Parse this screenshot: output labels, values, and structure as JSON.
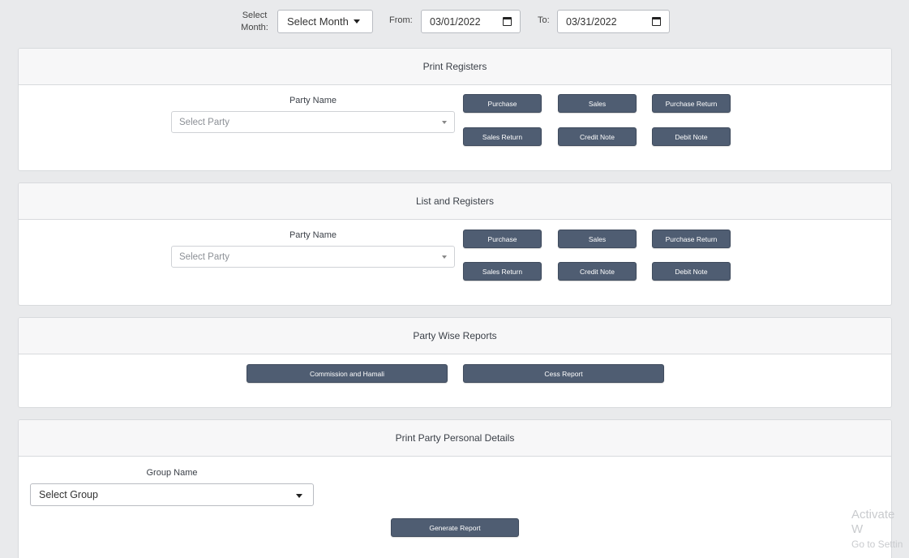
{
  "filters": {
    "month_label": "Select Month:",
    "month_value": "Select Month",
    "from_label": "From:",
    "from_value": "03/01/2022",
    "to_label": "To:",
    "to_value": "03/31/2022"
  },
  "print_registers": {
    "title": "Print Registers",
    "party_label": "Party Name",
    "party_placeholder": "Select Party",
    "buttons": [
      "Purchase",
      "Sales",
      "Purchase Return",
      "Sales Return",
      "Credit Note",
      "Debit Note"
    ]
  },
  "list_registers": {
    "title": "List and Registers",
    "party_label": "Party Name",
    "party_placeholder": "Select Party",
    "buttons": [
      "Purchase",
      "Sales",
      "Purchase Return",
      "Sales Return",
      "Credit Note",
      "Debit Note"
    ]
  },
  "party_wise": {
    "title": "Party Wise Reports",
    "buttons": [
      "Commission and Hamali",
      "Cess Report"
    ]
  },
  "personal_details": {
    "title": "Print Party Personal Details",
    "group_label": "Group Name",
    "group_value": "Select Group",
    "generate_label": "Generate Report"
  },
  "watermark": {
    "line1": "Activate W",
    "line2": "Go to Settin"
  }
}
